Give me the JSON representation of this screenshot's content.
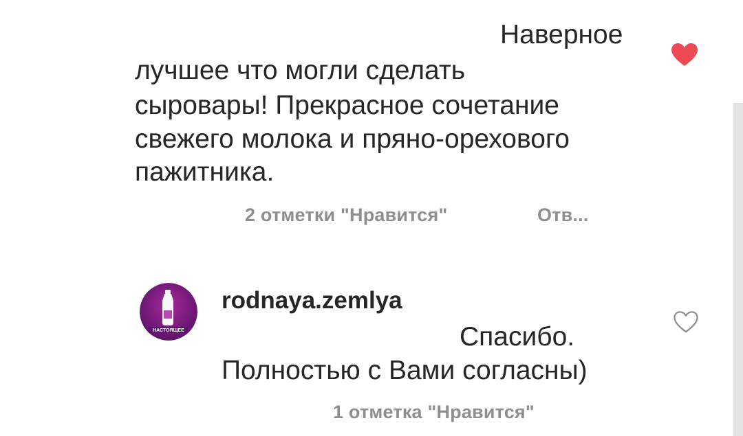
{
  "comment": {
    "lines": [
      "Наверное",
      "лучшее что могли сделать",
      "сыровары! Прекрасное сочетание",
      "свежего молока и пряно-орехового",
      "пажитника."
    ],
    "likes_label": "2 отметки \"Нравится\"",
    "reply_label": "Отв...",
    "liked": true,
    "heart_color": "#ed4956"
  },
  "reply": {
    "username": "rodnaya.zemlya",
    "avatar_text": "НАСТОЯЩЕЕ",
    "lines": [
      "Спасибо.",
      "Полностью с Вами согласны)"
    ],
    "likes_label": "1 отметка \"Нравится\"",
    "liked": false
  },
  "colors": {
    "text": "#262626",
    "meta": "#8e8e8e",
    "avatar_bg": "#6b1f7a"
  }
}
